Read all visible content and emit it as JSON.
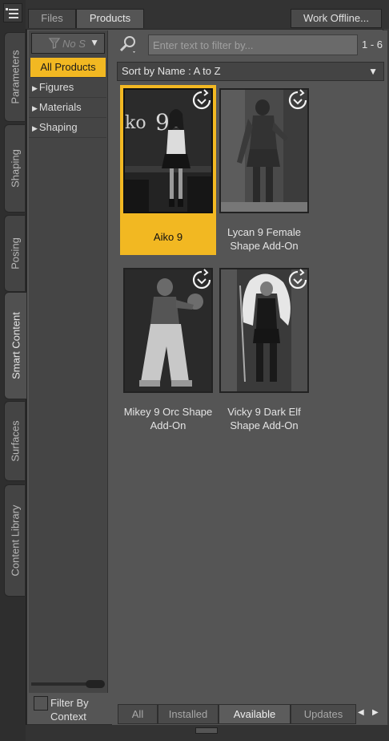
{
  "top_tabs": [
    {
      "label": "Files",
      "active": false
    },
    {
      "label": "Products",
      "active": true
    }
  ],
  "work_offline_label": "Work Offline...",
  "side_tabs": [
    {
      "label": "Parameters",
      "active": false
    },
    {
      "label": "Shaping",
      "active": false
    },
    {
      "label": "Posing",
      "active": false
    },
    {
      "label": "Smart Content",
      "active": true
    },
    {
      "label": "Surfaces",
      "active": false
    },
    {
      "label": "Content Library",
      "active": false
    }
  ],
  "category_filter": {
    "placeholder": "No S",
    "icon": "filter-icon"
  },
  "categories": [
    {
      "label": "All Products",
      "selected": true,
      "expandable": false
    },
    {
      "label": "Figures",
      "selected": false,
      "expandable": true
    },
    {
      "label": "Materials",
      "selected": false,
      "expandable": true
    },
    {
      "label": "Shaping",
      "selected": false,
      "expandable": true
    }
  ],
  "filter_by_context": {
    "label_line1": "Filter By",
    "label_line2": "Context",
    "checked": false
  },
  "search": {
    "placeholder": "Enter text to filter by...",
    "value": "",
    "range": "1 - 6"
  },
  "sort": {
    "label": "Sort by Name : A to Z"
  },
  "products": [
    {
      "name": "Aiko 9",
      "selected": true,
      "badge_icon": "sync-icon"
    },
    {
      "name": "Lycan 9 Female Shape Add-On",
      "selected": false,
      "badge_icon": "sync-icon"
    },
    {
      "name": "Mikey 9 Orc Shape Add-On",
      "selected": false,
      "badge_icon": "sync-icon"
    },
    {
      "name": "Vicky 9 Dark Elf Shape Add-On",
      "selected": false,
      "badge_icon": "sync-icon"
    }
  ],
  "bottom_tabs": [
    {
      "label": "All",
      "active": false
    },
    {
      "label": "Installed",
      "active": false
    },
    {
      "label": "Available",
      "active": true
    },
    {
      "label": "Updates",
      "active": false
    }
  ],
  "colors": {
    "selection": "#f2b822",
    "panel": "#555555",
    "background": "#3a3a3a"
  }
}
